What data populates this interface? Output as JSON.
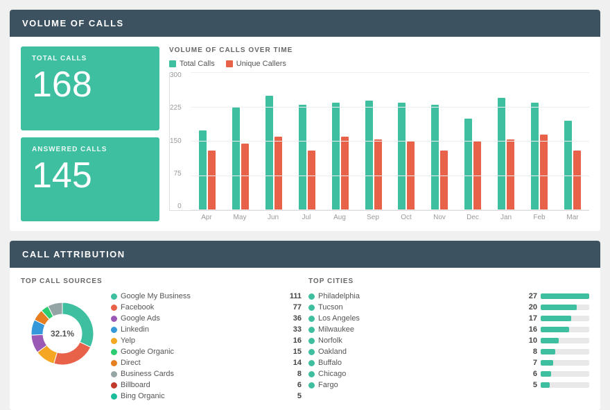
{
  "header": {
    "title": "VOLUME OF CALLS"
  },
  "stats": {
    "total_calls_label": "TOTAL CALLS",
    "total_calls_value": "168",
    "answered_calls_label": "ANSWERED CALLS",
    "answered_calls_value": "145"
  },
  "bar_chart": {
    "title": "VOLUME OF CALLS OVER TIME",
    "legend": {
      "total_calls": "Total Calls",
      "unique_callers": "Unique Callers"
    },
    "y_labels": [
      "0",
      "75",
      "150",
      "225",
      "300"
    ],
    "months": [
      "Apr",
      "May",
      "Jun",
      "Jul",
      "Aug",
      "Sep",
      "Oct",
      "Nov",
      "Dec",
      "Jan",
      "Feb",
      "Mar"
    ],
    "total_data": [
      175,
      225,
      250,
      230,
      235,
      240,
      235,
      230,
      200,
      245,
      235,
      195
    ],
    "unique_data": [
      130,
      145,
      160,
      130,
      160,
      155,
      150,
      130,
      150,
      155,
      165,
      130
    ]
  },
  "attribution": {
    "header": "CALL ATTRIBUTION",
    "sources_title": "TOP CALL SOURCES",
    "cities_title": "TOP CITIES",
    "donut_label": "32.1%",
    "donut_segments": [
      {
        "color": "#3dbfa0",
        "pct": 32.1
      },
      {
        "color": "#e8624a",
        "pct": 22.3
      },
      {
        "color": "#f5a623",
        "pct": 10.4
      },
      {
        "color": "#9b59b6",
        "pct": 9.5
      },
      {
        "color": "#3498db",
        "pct": 8.0
      },
      {
        "color": "#e67e22",
        "pct": 6.0
      },
      {
        "color": "#2ecc71",
        "pct": 4.0
      },
      {
        "color": "#95a5a6",
        "pct": 7.7
      }
    ],
    "sources": [
      {
        "name": "Google My Business",
        "count": "111",
        "color": "#3dbfa0"
      },
      {
        "name": "Facebook",
        "count": "77",
        "color": "#e8624a"
      },
      {
        "name": "Google Ads",
        "count": "36",
        "color": "#9b59b6"
      },
      {
        "name": "Linkedin",
        "count": "33",
        "color": "#3498db"
      },
      {
        "name": "Yelp",
        "count": "16",
        "color": "#f5a623"
      },
      {
        "name": "Google Organic",
        "count": "15",
        "color": "#2ecc71"
      },
      {
        "name": "Direct",
        "count": "14",
        "color": "#e67e22"
      },
      {
        "name": "Business Cards",
        "count": "8",
        "color": "#95a5a6"
      },
      {
        "name": "Billboard",
        "count": "6",
        "color": "#c0392b"
      },
      {
        "name": "Bing Organic",
        "count": "5",
        "color": "#1abc9c"
      }
    ],
    "cities": [
      {
        "name": "Philadelphia",
        "count": "27",
        "pct": 100,
        "color": "#3dbfa0"
      },
      {
        "name": "Tucson",
        "count": "20",
        "pct": 74,
        "color": "#3dbfa0"
      },
      {
        "name": "Los Angeles",
        "count": "17",
        "pct": 63,
        "color": "#3dbfa0"
      },
      {
        "name": "Milwaukee",
        "count": "16",
        "pct": 59,
        "color": "#3dbfa0"
      },
      {
        "name": "Norfolk",
        "count": "10",
        "pct": 37,
        "color": "#3dbfa0"
      },
      {
        "name": "Oakland",
        "count": "8",
        "pct": 30,
        "color": "#3dbfa0"
      },
      {
        "name": "Buffalo",
        "count": "7",
        "pct": 26,
        "color": "#3dbfa0"
      },
      {
        "name": "Chicago",
        "count": "6",
        "pct": 22,
        "color": "#3dbfa0"
      },
      {
        "name": "Fargo",
        "count": "5",
        "pct": 19,
        "color": "#3dbfa0"
      }
    ]
  }
}
